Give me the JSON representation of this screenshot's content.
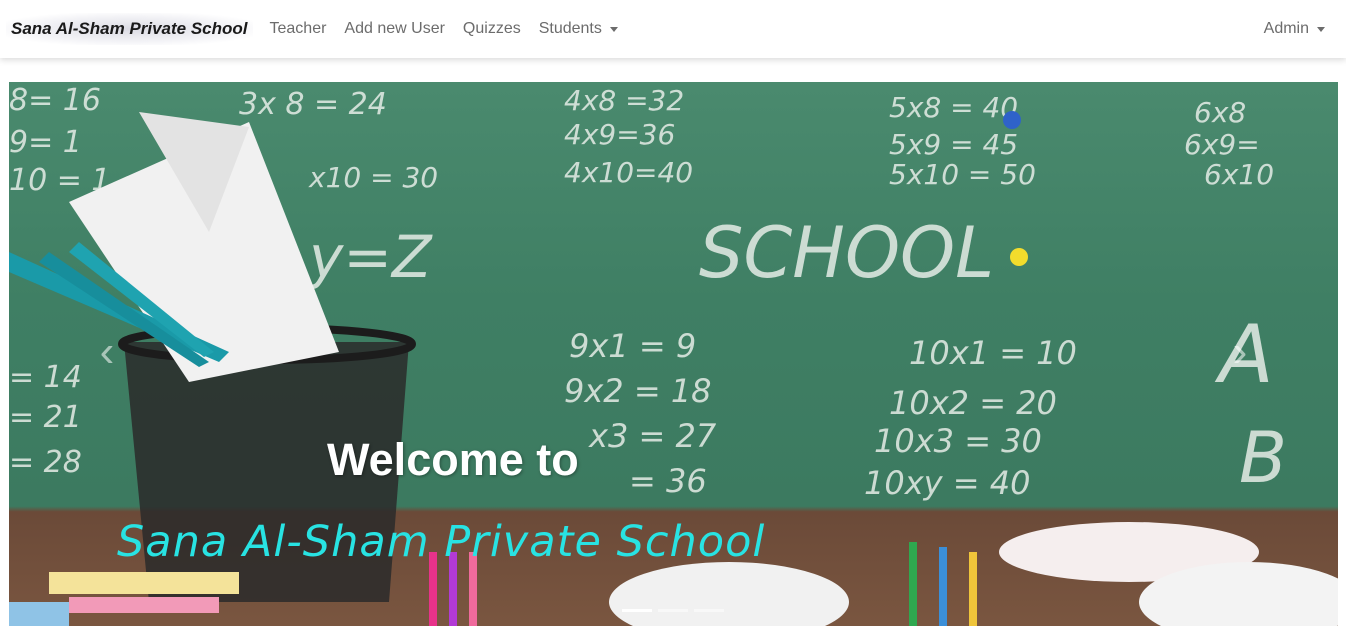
{
  "navbar": {
    "brand": "Sana Al-Sham Private School",
    "items": [
      {
        "label": "Teacher"
      },
      {
        "label": "Add new User"
      },
      {
        "label": "Quizzes"
      },
      {
        "label": "Students"
      }
    ],
    "user_menu": {
      "label": "Admin"
    }
  },
  "carousel": {
    "caption_title": "Welcome to",
    "caption_subtitle": "Sana Al-Sham Private School",
    "subtitle_color": "#28e3e3",
    "indicators": [
      true,
      false,
      false
    ],
    "prev_icon": "chevron-left-icon",
    "next_icon": "chevron-right-icon"
  },
  "colors": {
    "board_green": "#3f7f64",
    "nav_text": "#6c6c6c"
  }
}
